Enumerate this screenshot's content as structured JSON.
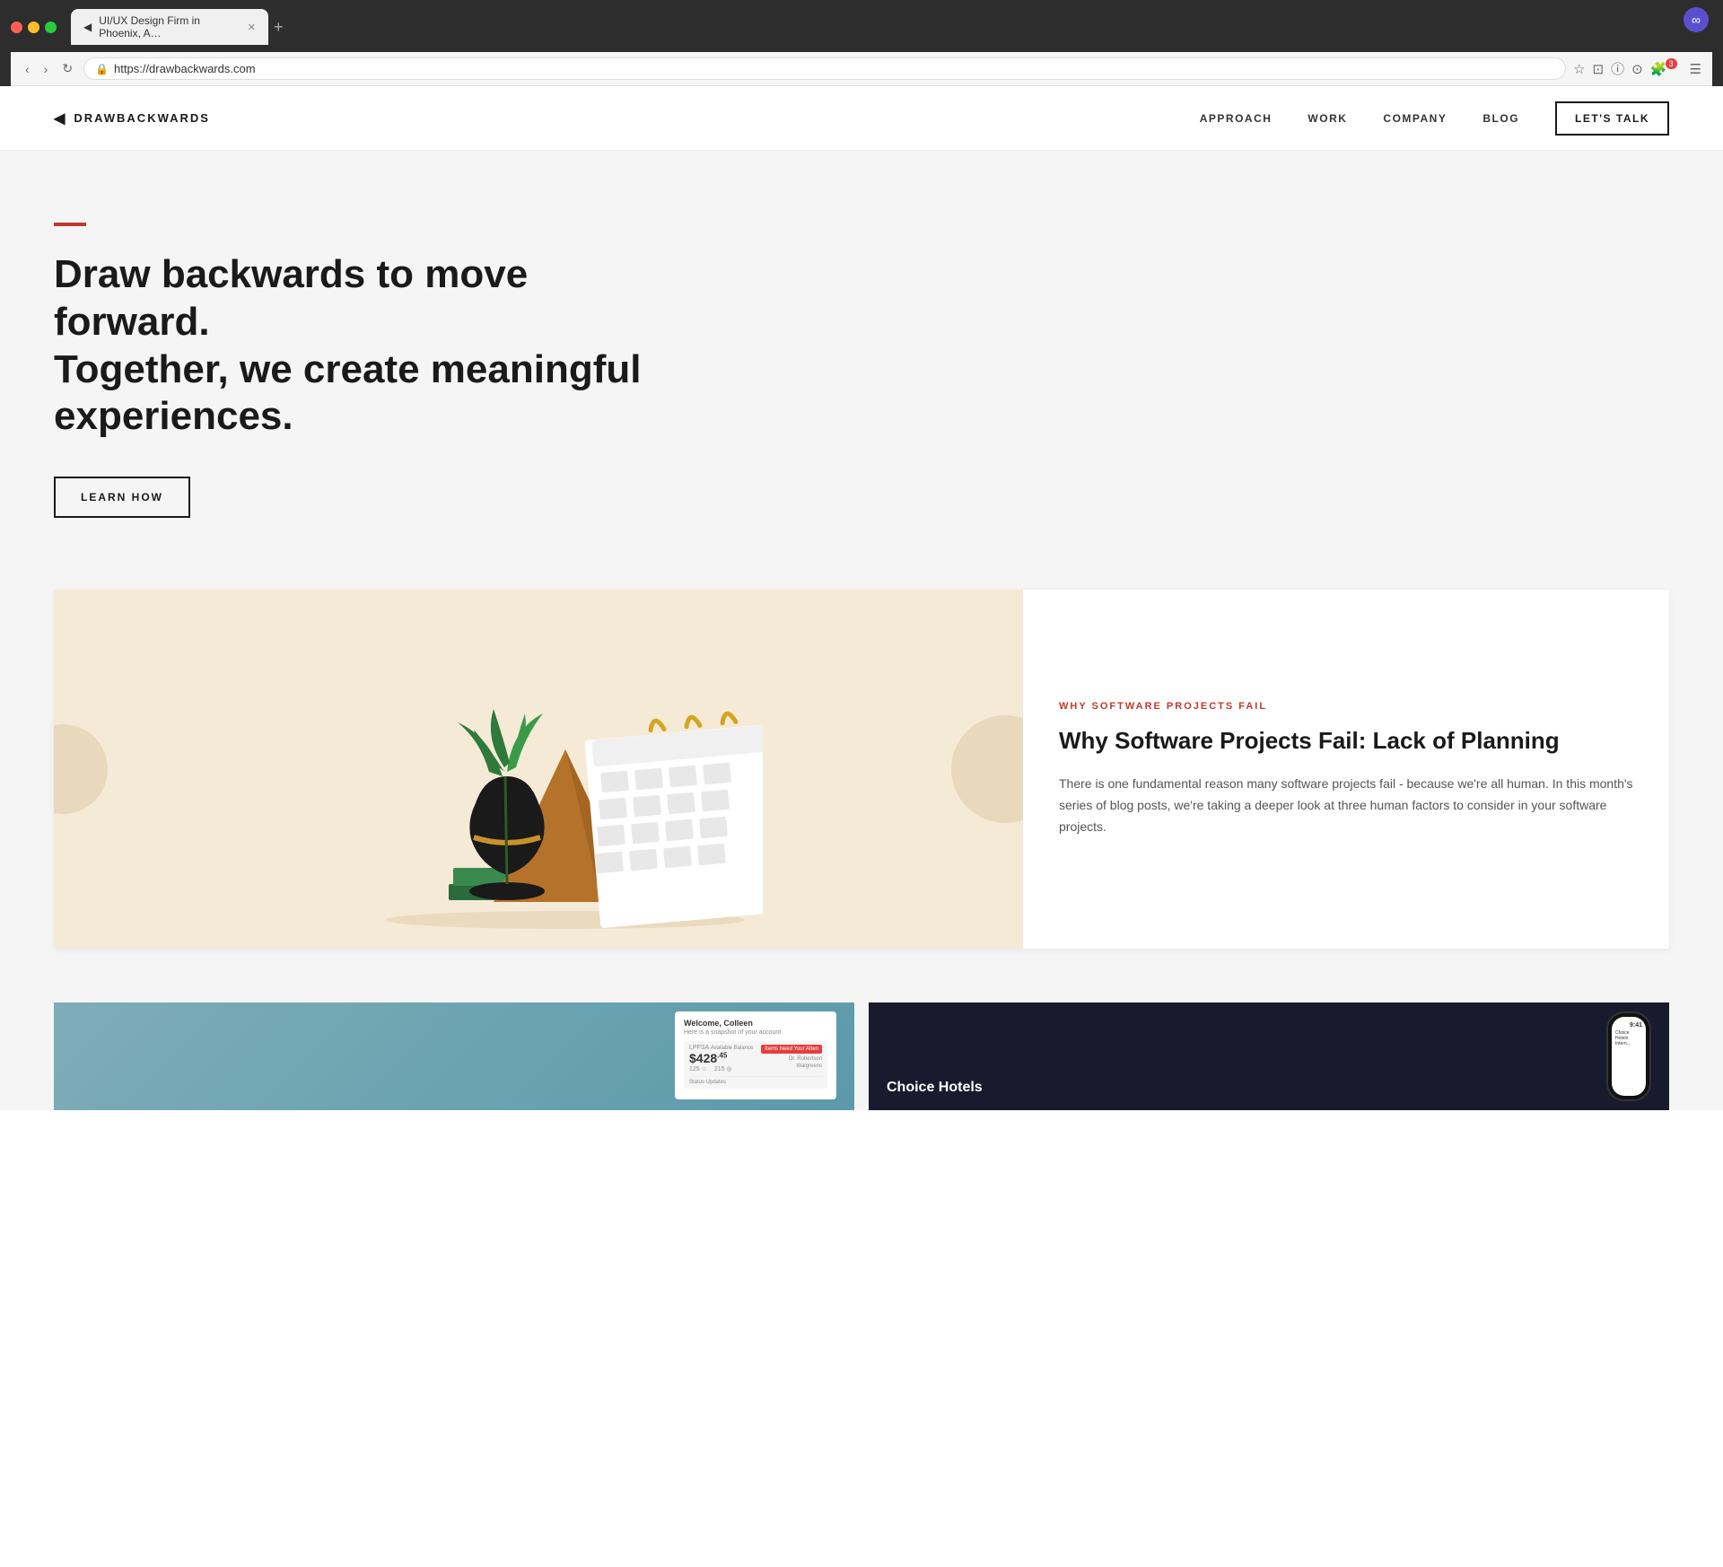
{
  "browser": {
    "tab_title": "UI/UX Design Firm in Phoenix, A…",
    "url": "https://drawbackwards.com",
    "new_tab_label": "+",
    "favicon": "◀"
  },
  "nav": {
    "logo_text": "DRAWBACKWARDS",
    "logo_icon": "◀",
    "links": [
      {
        "label": "APPROACH",
        "id": "approach"
      },
      {
        "label": "WORK",
        "id": "work"
      },
      {
        "label": "COMPANY",
        "id": "company"
      },
      {
        "label": "BLOG",
        "id": "blog"
      }
    ],
    "cta_label": "LET'S TALK"
  },
  "hero": {
    "title_line1": "Draw backwards to move forward.",
    "title_line2": "Together, we create meaningful experiences.",
    "cta_label": "LEARN HOW"
  },
  "featured": {
    "category": "WHY SOFTWARE PROJECTS FAIL",
    "title": "Why Software Projects Fail: Lack of Planning",
    "description": "There is one fundamental reason many software projects fail - because we're all human. In this month's series of blog posts, we're taking a deeper look at three human factors to consider in your software projects."
  },
  "portfolio": {
    "left": {
      "dashboard": {
        "welcome": "Welcome, Colleen",
        "subtitle": "Here is a snapshot of your account",
        "brand": "LPFSA",
        "brand_sub": "Available Balance",
        "amount_dollars": "$428",
        "amount_cents": ".45",
        "stat1": "125 ☆",
        "stat2": "215 ◎",
        "status": "Status Updates",
        "items_label": "Items Need Your Atten",
        "item1": "Dr. Robertson",
        "item2": "Walgreens"
      }
    },
    "right": {
      "label": "Choice Hotels",
      "phone_time": "9:41",
      "phone_brand": "Choice Hotels Intern…"
    }
  }
}
